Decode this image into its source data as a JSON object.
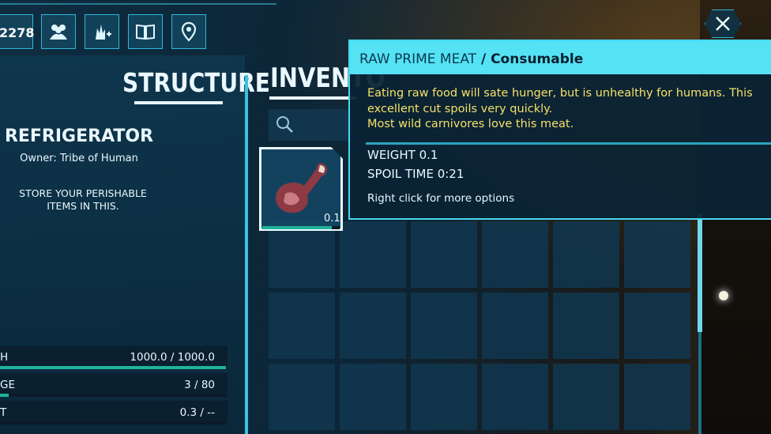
{
  "hud": {
    "counter_value": "2278",
    "icons": [
      "tribe-icon",
      "breed-icon",
      "engram-book-icon",
      "map-pin-icon"
    ]
  },
  "structure_panel": {
    "title": "STRUCTURE",
    "name": "REFRIGERATOR",
    "owner": "Owner: Tribe of Human",
    "description": "STORE YOUR PERISHABLE ITEMS IN THIS.",
    "stats": [
      {
        "label": "H",
        "value": "1000.0 / 1000.0",
        "fill": 1.0
      },
      {
        "label": "GE",
        "value": "3 / 80",
        "fill": 0.0375
      },
      {
        "label": "T",
        "value": "0.3 / --",
        "fill": 0.0
      }
    ]
  },
  "inventory": {
    "title": "INVENTO",
    "selected_item": {
      "icon": "raw-prime-meat-icon",
      "quantity_label": "0.1",
      "spoil_fill": 0.9
    }
  },
  "tooltip": {
    "item_name": "RAW PRIME MEAT",
    "separator": " / ",
    "item_type": "Consumable",
    "description_lines": [
      "Eating raw food will sate hunger, but is unhealthy for humans.  This",
      "excellent cut spoils very quickly.",
      "Most wild carnivores love this meat."
    ],
    "weight": "WEIGHT 0.1",
    "spoil_time": "SPOIL TIME 0:21",
    "hint": "Right click for more options"
  },
  "colors": {
    "accent": "#46d8f2",
    "tooltip_header": "#55e2f5",
    "description_text": "#f6e06a",
    "bar_fill": "#1fb39a"
  }
}
